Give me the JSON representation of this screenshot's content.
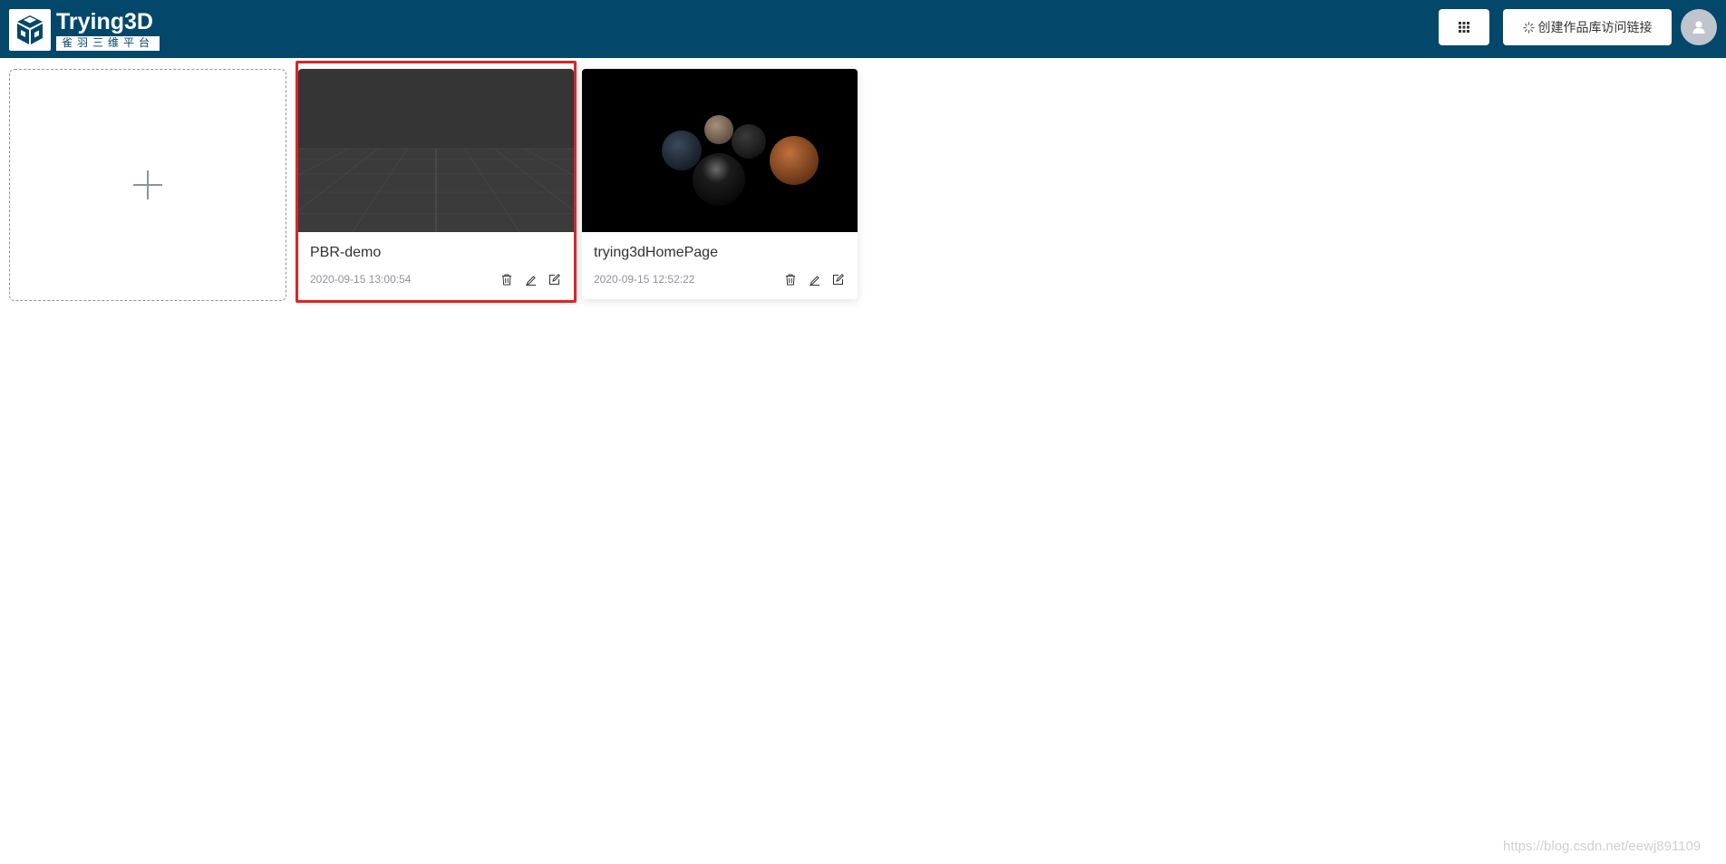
{
  "header": {
    "brand_title": "Trying3D",
    "brand_subtitle": "雀羽三维平台",
    "grid_button_icon": "grid-icon",
    "link_button_label": "创建作品库访问链接",
    "link_button_icon": "loading-spinner-icon",
    "avatar_icon": "user-icon",
    "bg_color": "#03476b"
  },
  "add_card": {
    "icon": "plus-icon"
  },
  "projects": [
    {
      "name": "PBR-demo",
      "date": "2020-09-15 13:00:54",
      "selected": true
    },
    {
      "name": "trying3dHomePage",
      "date": "2020-09-15 12:52:22",
      "selected": false
    }
  ],
  "card_actions": [
    "trash-icon",
    "edit-pen-icon",
    "edit-square-icon"
  ],
  "selection_color": "#e02323",
  "watermark": "https://blog.csdn.net/eewj891109"
}
